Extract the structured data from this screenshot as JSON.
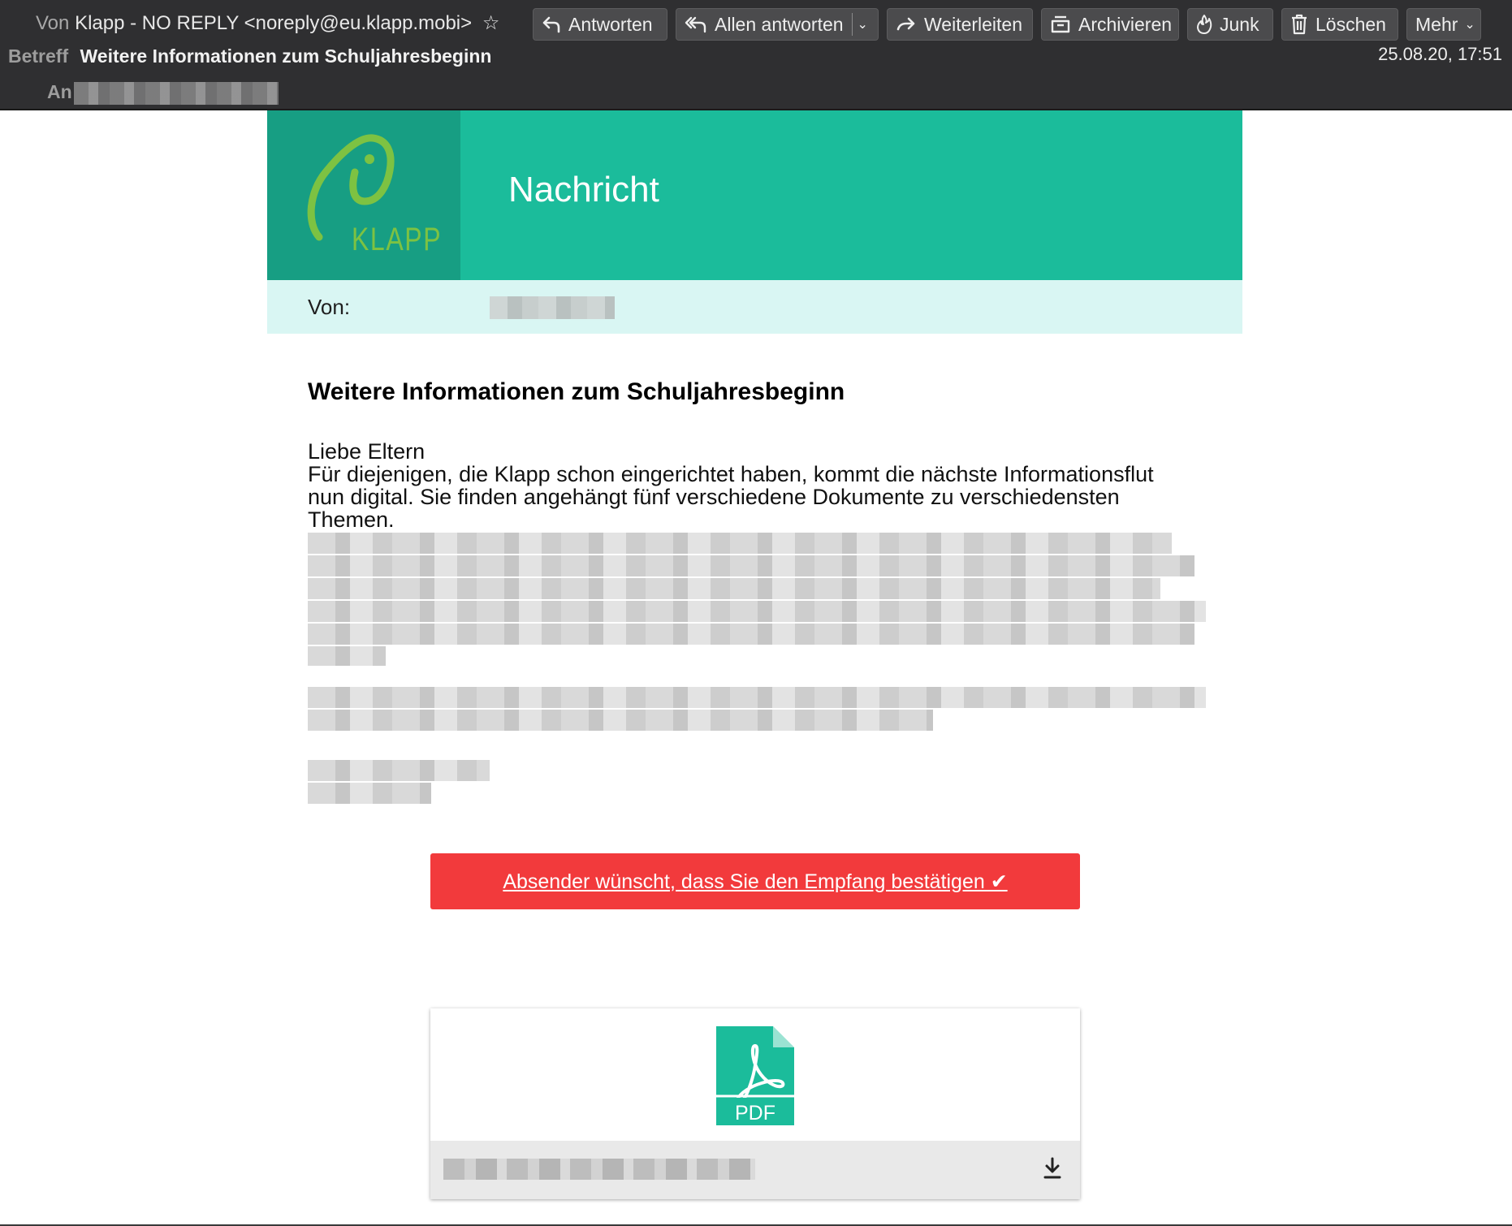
{
  "header": {
    "from_label": "Von",
    "from_value": "Klapp - NO REPLY <noreply@eu.klapp.mobi>",
    "subject_label": "Betreff",
    "subject_value": "Weitere Informationen zum Schuljahresbeginn",
    "to_label": "An",
    "date": "25.08.20, 17:51"
  },
  "toolbar": {
    "reply": "Antworten",
    "reply_all": "Allen antworten",
    "forward": "Weiterleiten",
    "archive": "Archivieren",
    "junk": "Junk",
    "delete": "Löschen",
    "more": "Mehr"
  },
  "banner": {
    "logo_text": "KLAPP",
    "title": "Nachricht",
    "from_label": "Von:"
  },
  "message": {
    "title": "Weitere Informationen zum Schuljahresbeginn",
    "greeting": "Liebe Eltern",
    "line1": "Für diejenigen, die Klapp schon eingerichtet haben, kommt die nächste Informationsflut",
    "line2": "nun digital. Sie finden angehängt fünf verschiedene Dokumente zu verschiedensten",
    "line3": "Themen."
  },
  "confirm_button": "Absender wünscht, dass Sie den Empfang bestätigen ✔",
  "attachment": {
    "type_label": "PDF"
  },
  "colors": {
    "header_bg": "#2f2f31",
    "banner_green": "#1bbc9b",
    "logo_green": "#179e83",
    "logo_lime": "#7dc242",
    "von_row": "#d9f6f3",
    "confirm_red": "#f23a3c"
  }
}
